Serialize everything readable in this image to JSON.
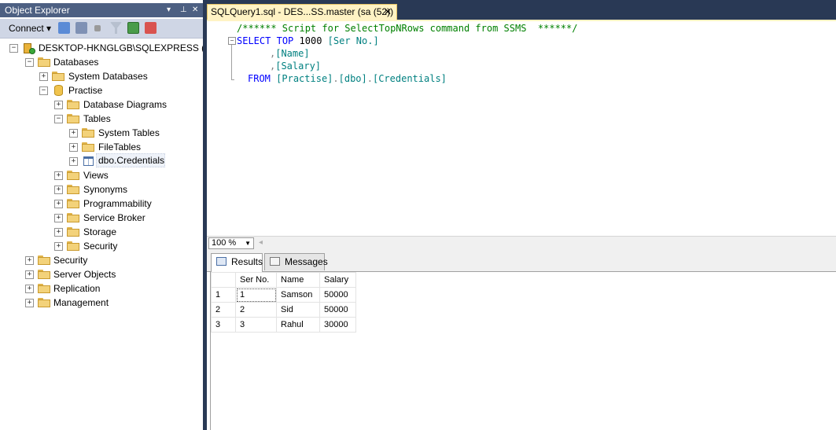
{
  "object_explorer": {
    "title": "Object Explorer",
    "pin_controls": "▾ ⊥ ✕",
    "toolbar": {
      "connect_label": "Connect ▾"
    },
    "tree": [
      {
        "label": "DESKTOP-HKNGLGB\\SQLEXPRESS (SQL",
        "depth": 0,
        "icon": "server-icon",
        "expander": "−"
      },
      {
        "label": "Databases",
        "depth": 1,
        "icon": "folder-icon",
        "expander": "−"
      },
      {
        "label": "System Databases",
        "depth": 2,
        "icon": "folder-icon",
        "expander": "+"
      },
      {
        "label": "Practise",
        "depth": 2,
        "icon": "database-icon",
        "expander": "−"
      },
      {
        "label": "Database Diagrams",
        "depth": 3,
        "icon": "folder-icon",
        "expander": "+"
      },
      {
        "label": "Tables",
        "depth": 3,
        "icon": "folder-icon",
        "expander": "−"
      },
      {
        "label": "System Tables",
        "depth": 4,
        "icon": "folder-icon",
        "expander": "+"
      },
      {
        "label": "FileTables",
        "depth": 4,
        "icon": "folder-icon",
        "expander": "+"
      },
      {
        "label": "dbo.Credentials",
        "depth": 4,
        "icon": "table-icon",
        "expander": "+",
        "selected": true
      },
      {
        "label": "Views",
        "depth": 3,
        "icon": "folder-icon",
        "expander": "+"
      },
      {
        "label": "Synonyms",
        "depth": 3,
        "icon": "folder-icon",
        "expander": "+"
      },
      {
        "label": "Programmability",
        "depth": 3,
        "icon": "folder-icon",
        "expander": "+"
      },
      {
        "label": "Service Broker",
        "depth": 3,
        "icon": "folder-icon",
        "expander": "+"
      },
      {
        "label": "Storage",
        "depth": 3,
        "icon": "folder-icon",
        "expander": "+"
      },
      {
        "label": "Security",
        "depth": 3,
        "icon": "folder-icon",
        "expander": "+"
      },
      {
        "label": "Security",
        "depth": 1,
        "icon": "folder-icon",
        "expander": "+"
      },
      {
        "label": "Server Objects",
        "depth": 1,
        "icon": "folder-icon",
        "expander": "+"
      },
      {
        "label": "Replication",
        "depth": 1,
        "icon": "folder-icon",
        "expander": "+"
      },
      {
        "label": "Management",
        "depth": 1,
        "icon": "folder-icon",
        "expander": "+"
      }
    ]
  },
  "document": {
    "tab_title": "SQLQuery1.sql - DES...SS.master (sa (52))",
    "tab_close": "✕",
    "code": {
      "comment": "/****** Script for SelectTopNRows command from SSMS  ******/",
      "line2_kw1": "SELECT",
      "line2_kw2": "TOP",
      "line2_num": "1000",
      "line2_id": "[Ser No.]",
      "line3_comma": ",",
      "line3_id": "[Name]",
      "line4_comma": ",",
      "line4_id": "[Salary]",
      "line5_kw": "FROM",
      "line5_id1": "[Practise]",
      "line5_dot1": ".",
      "line5_id2": "[dbo]",
      "line5_dot2": ".",
      "line5_id3": "[Credentials]"
    },
    "zoom": "100 %"
  },
  "results": {
    "tabs": [
      {
        "label": "Results",
        "active": true
      },
      {
        "label": "Messages",
        "active": false
      }
    ],
    "columns": [
      "Ser No.",
      "Name",
      "Salary"
    ],
    "rows": [
      {
        "rownum": "1",
        "ser_no": "1",
        "name": "Samson",
        "salary": "50000"
      },
      {
        "rownum": "2",
        "ser_no": "2",
        "name": "Sid",
        "salary": "50000"
      },
      {
        "rownum": "3",
        "ser_no": "3",
        "name": "Rahul",
        "salary": "30000"
      }
    ]
  }
}
